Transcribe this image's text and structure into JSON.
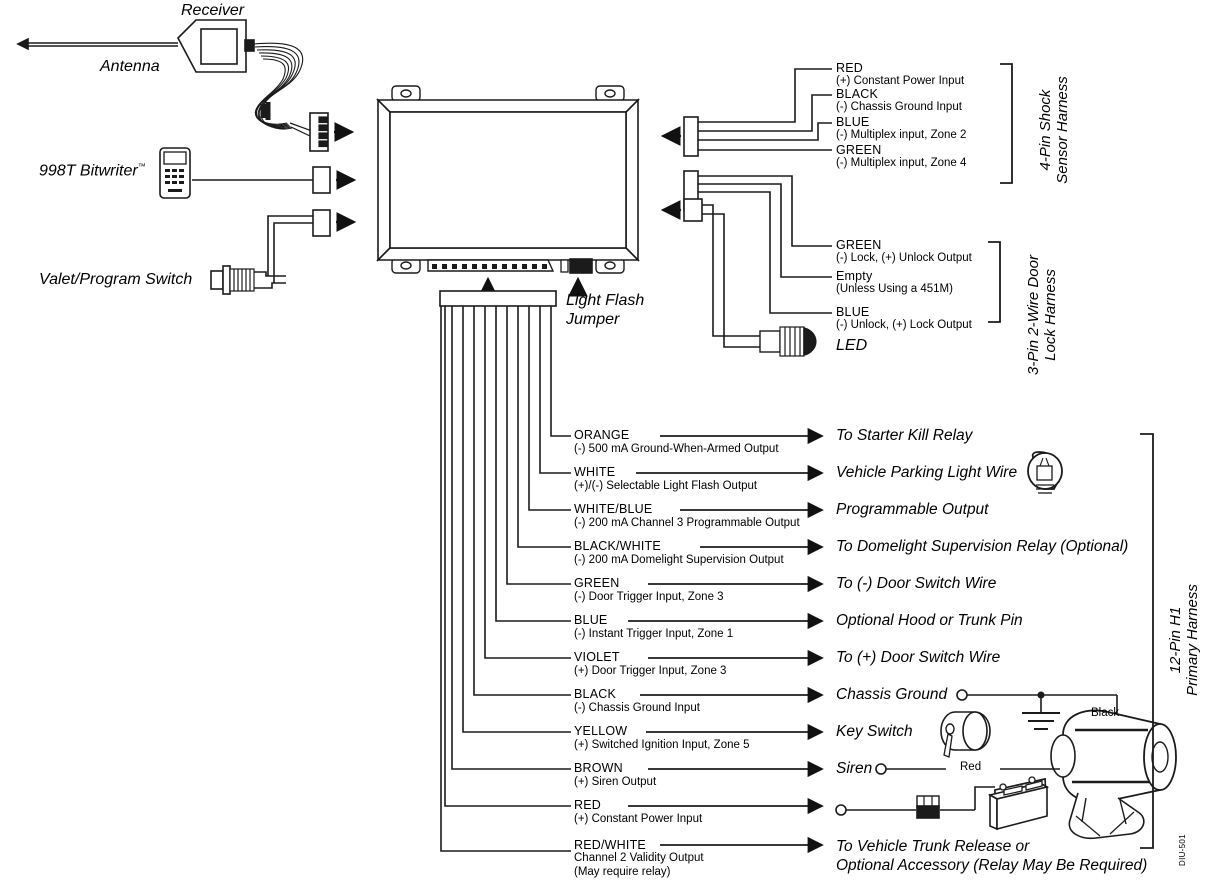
{
  "doc": {
    "code": "DIU-501"
  },
  "components": {
    "antenna": "Antenna",
    "receiver": "Receiver",
    "bitwriter": "998T  Bitwriter",
    "bitwriter_tm": "™",
    "valet_switch": "Valet/Program Switch",
    "light_flash_jumper_line1": "Light Flash",
    "light_flash_jumper_line2": "Jumper",
    "led": "LED",
    "siren_black_wire": "Black",
    "siren_red_wire": "Red"
  },
  "harness_shock": {
    "title_line1": "4-Pin Shock",
    "title_line2": "Sensor Harness",
    "wires": [
      {
        "name": "RED",
        "desc": "(+) Constant Power Input"
      },
      {
        "name": "BLACK",
        "desc": "(-) Chassis Ground Input"
      },
      {
        "name": "BLUE",
        "desc": "(-) Multiplex input, Zone 2"
      },
      {
        "name": "GREEN",
        "desc": "(-) Multiplex input, Zone 4"
      }
    ]
  },
  "harness_door_lock": {
    "title_line1": "3-Pin 2-Wire Door",
    "title_line2": "Lock Harness",
    "wires": [
      {
        "name": "GREEN",
        "desc": "(-) Lock, (+) Unlock Output"
      },
      {
        "name": "Empty",
        "desc": "(Unless Using a 451M)"
      },
      {
        "name": "BLUE",
        "desc": "(-) Unlock, (+) Lock Output"
      }
    ]
  },
  "harness_primary": {
    "title_line1": "12-Pin H1",
    "title_line2": "Primary Harness",
    "wires": [
      {
        "name": "ORANGE",
        "desc": "(-) 500 mA Ground-When-Armed Output",
        "dest": "To Starter Kill Relay"
      },
      {
        "name": "WHITE",
        "desc": "(+)/(-) Selectable Light Flash Output",
        "dest": "Vehicle Parking Light Wire"
      },
      {
        "name": "WHITE/BLUE",
        "desc": "(-) 200 mA Channel 3 Programmable Output",
        "dest": "Programmable Output"
      },
      {
        "name": "BLACK/WHITE",
        "desc": "(-) 200 mA Domelight Supervision Output",
        "dest": "To Domelight Supervision Relay (Optional)"
      },
      {
        "name": "GREEN",
        "desc": "(-) Door Trigger Input, Zone 3",
        "dest": "To (-) Door Switch Wire"
      },
      {
        "name": "BLUE",
        "desc": "(-) Instant Trigger Input, Zone 1",
        "dest": "Optional Hood or Trunk Pin"
      },
      {
        "name": "VIOLET",
        "desc": "(+) Door Trigger Input, Zone 3",
        "dest": "To (+) Door Switch Wire"
      },
      {
        "name": "BLACK",
        "desc": "(-) Chassis Ground Input",
        "dest": "Chassis Ground"
      },
      {
        "name": "YELLOW",
        "desc": "(+) Switched Ignition Input, Zone 5",
        "dest": "Key Switch"
      },
      {
        "name": "BROWN",
        "desc": "(+) Siren Output",
        "dest": "Siren"
      },
      {
        "name": "RED",
        "desc": "(+) Constant Power Input",
        "dest": ""
      },
      {
        "name": "RED/WHITE",
        "desc": "Channel 2 Validity Output",
        "desc2": "(May require relay)",
        "dest_line1": "To Vehicle Trunk Release or",
        "dest_line2": "Optional Accessory (Relay May Be Required)"
      }
    ]
  }
}
